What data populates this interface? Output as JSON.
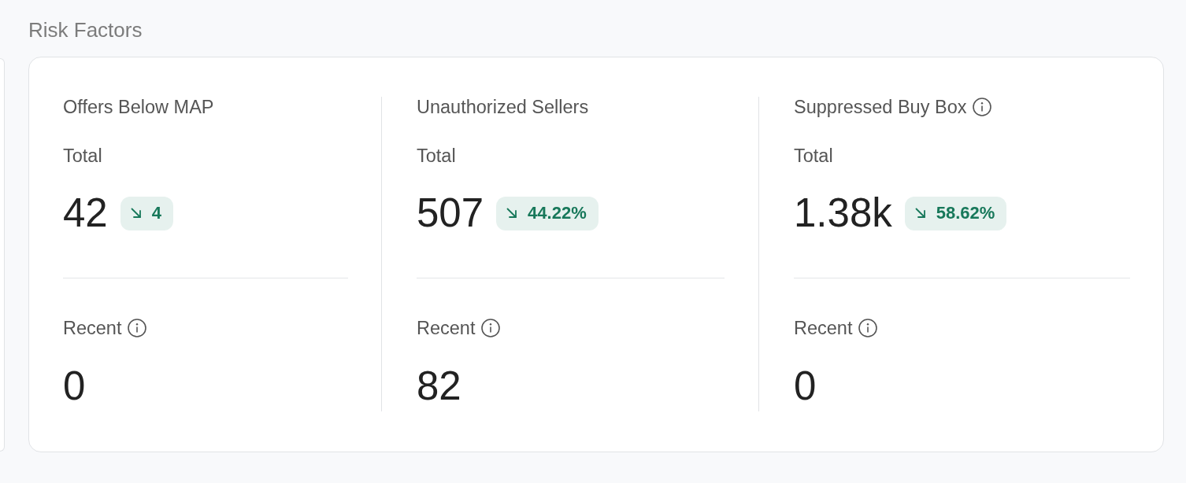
{
  "section": {
    "title": "Risk Factors"
  },
  "metrics": [
    {
      "title": "Offers Below MAP",
      "title_info": false,
      "total_label": "Total",
      "total": "42",
      "change": {
        "decreasing": true,
        "text": "4"
      },
      "recent_label": "Recent",
      "recent_info": true,
      "recent": "0"
    },
    {
      "title": "Unauthorized Sellers",
      "title_info": false,
      "total_label": "Total",
      "total": "507",
      "change": {
        "decreasing": true,
        "text": "44.22%"
      },
      "recent_label": "Recent",
      "recent_info": true,
      "recent": "82"
    },
    {
      "title": "Suppressed Buy Box",
      "title_info": true,
      "total_label": "Total",
      "total": "1.38k",
      "change": {
        "decreasing": true,
        "text": "58.62%"
      },
      "recent_label": "Recent",
      "recent_info": true,
      "recent": "0"
    }
  ]
}
